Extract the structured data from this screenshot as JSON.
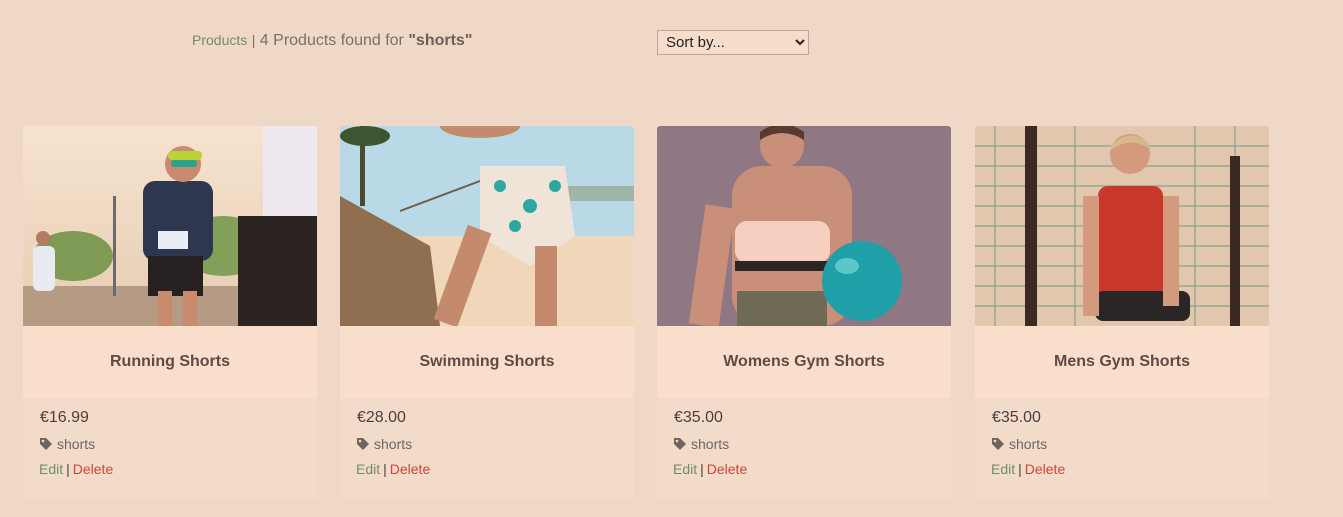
{
  "header": {
    "breadcrumb": "Products",
    "separator": "|",
    "results_prefix": "4 Products found for",
    "query": "\"shorts\"",
    "sort_value": "Sort by..."
  },
  "products": [
    {
      "name": "Running Shorts",
      "price": "€16.99",
      "tag": "shorts",
      "edit": "Edit",
      "delete": "Delete"
    },
    {
      "name": "Swimming Shorts",
      "price": "€28.00",
      "tag": "shorts",
      "edit": "Edit",
      "delete": "Delete"
    },
    {
      "name": "Womens Gym Shorts",
      "price": "€35.00",
      "tag": "shorts",
      "edit": "Edit",
      "delete": "Delete"
    },
    {
      "name": "Mens Gym Shorts",
      "price": "€35.00",
      "tag": "shorts",
      "edit": "Edit",
      "delete": "Delete"
    }
  ],
  "colors": {
    "background": "#f0d8c6",
    "card": "#f3dbc9",
    "name_band": "#f9decb",
    "link_green": "#6f8f66",
    "delete_red": "#c9473b"
  }
}
